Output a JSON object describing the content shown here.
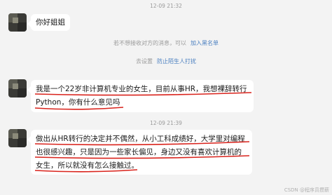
{
  "messages": [
    {
      "time": "12-09 21:32",
      "text": "你好姐姐"
    },
    {
      "text_lines": [
        "我是一个22岁非计算机专业的女生，目前从事HR，我想裸辞转行",
        "Python，你有什么意见吗"
      ]
    },
    {
      "time": "12-09 21:39",
      "text_lines": [
        "做出从HR转行的决定并不偶然，从小工科成绩好，大学里对编程",
        "也很感兴趣，只是因为一些家长偏见，身边又没有喜欢计算机的",
        "女生，所以就没有怎么接触过。"
      ]
    }
  ],
  "system": {
    "notice": "若不想接收对方的消息，可以",
    "blacklist_link": "加入黑名单",
    "settings_prefix": "去设置",
    "anti_harass_link": "防止陌生人打扰"
  },
  "watermark": "CSDN @程序员攒薪",
  "colors": {
    "underline": "#d9231c",
    "link": "#4a7fc0"
  }
}
